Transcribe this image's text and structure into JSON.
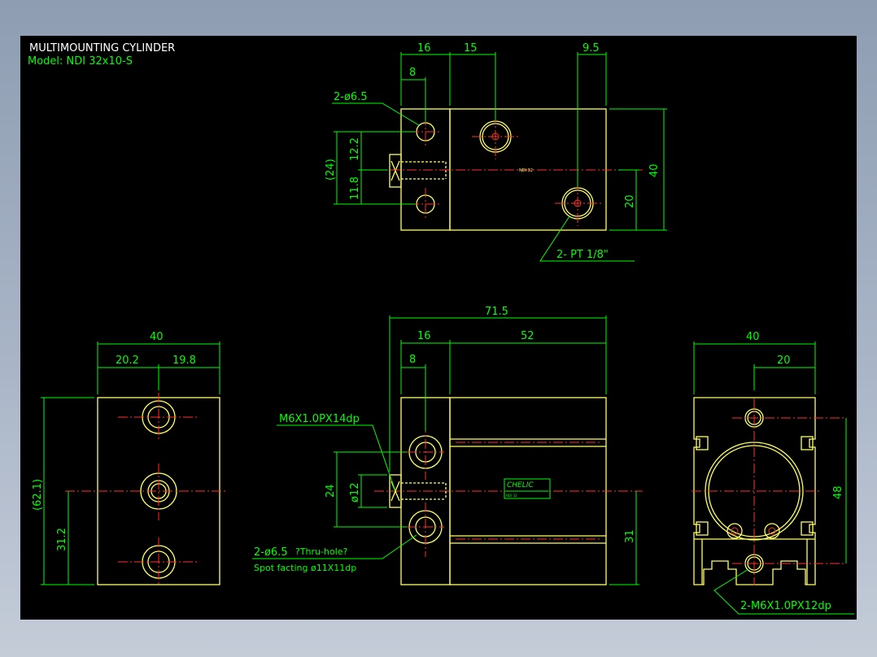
{
  "drawing": {
    "title": "MULTIMOUNTING CYLINDER",
    "model": "Model:  NDI  32x10-S",
    "brand_label": "CHELIC",
    "brand_small": "NDI 32"
  },
  "top_view": {
    "dims": {
      "w16": "16",
      "w15": "15",
      "w9_5": "9.5",
      "w8": "8",
      "h24": "(24)",
      "h12_2": "12.2",
      "h11_8": "11.8",
      "h40": "40",
      "h20": "20"
    },
    "callout_holes": "2-ø6.5",
    "callout_ports": "2- PT 1/8\""
  },
  "left_view": {
    "dims": {
      "w40": "40",
      "w20_2": "20.2",
      "w19_8": "19.8",
      "h62_1": "(62.1)",
      "h31_2": "31.2"
    }
  },
  "front_view": {
    "dims": {
      "w71_5": "71.5",
      "w16": "16",
      "w52": "52",
      "w8": "8",
      "h24": "24",
      "d12": "ø12",
      "h31": "31"
    },
    "callout_thread": "M6X1.0PX14dp",
    "callout_holes": "2-ø6.5",
    "callout_holes_note": "?Thru-hole?",
    "callout_spot": "Spot facting   ø11X11dp"
  },
  "right_view": {
    "dims": {
      "w40": "40",
      "w20": "20",
      "h48": "48"
    },
    "callout_thread": "2-M6X1.0PX12dp"
  }
}
